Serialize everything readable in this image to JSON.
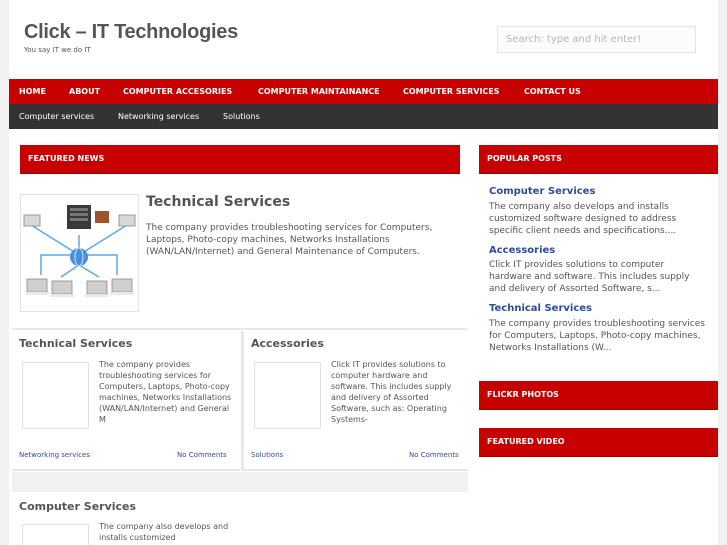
{
  "header": {
    "site_title": "Click – IT Technologies",
    "tagline": "You say IT we do IT",
    "search_placeholder": "Search: type and hit enter!"
  },
  "primary_nav": [
    "HOME",
    "ABOUT",
    "COMPUTER ACCESORIES",
    "COMPUTER MAINTAINANCE",
    "COMPUTER SERVICES",
    "CONTACT US"
  ],
  "secondary_nav": [
    "Computer services",
    "Networking services",
    "Solutions"
  ],
  "featured": {
    "heading": "FEATURED NEWS",
    "title": "Technical Services",
    "excerpt": "The company provides troubleshooting services for Computers, Laptops, Photo-copy machines, Networks Installations (WAN/LAN/Internet) and General Maintenance of Computers."
  },
  "cards": [
    {
      "title": "Technical Services",
      "excerpt": "The company provides troubleshooting services for Computers, Laptops, Photo-copy machines, Networks Installations (WAN/LAN/Internet) and General M",
      "category": "Networking services",
      "comments": "No Comments"
    },
    {
      "title": "Accessories",
      "excerpt": "Click IT provides solutions to computer hardware and software. This includes supply and delivery of Assorted Software, such as: Operating Systems-",
      "category": "Solutions",
      "comments": "No Comments"
    },
    {
      "title": "Computer Services",
      "excerpt": "The company also develops and installs customized"
    }
  ],
  "sidebar": {
    "popular_heading": "POPULAR POSTS",
    "popular": [
      {
        "title": "Computer Services",
        "excerpt": "The company also develops and installs customized software designed to address specific client needs and specifications...."
      },
      {
        "title": "Accessories",
        "excerpt": "Click IT provides solutions to computer hardware and software. This includes supply and delivery of Assorted Software, s..."
      },
      {
        "title": "Technical Services",
        "excerpt": "The company provides troubleshooting services for Computers, Laptops, Photo-copy machines, Networks Installations (W..."
      }
    ],
    "flickr_heading": "FLICKR PHOTOS",
    "video_heading": "FEATURED VIDEO"
  },
  "colors": {
    "accent": "#c70000",
    "subnav": "#333333",
    "link": "#2e4b9b"
  }
}
